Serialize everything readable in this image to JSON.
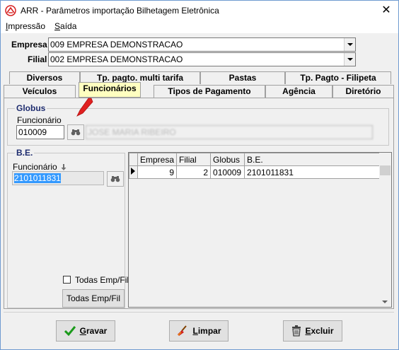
{
  "window": {
    "title": "ARR - Parâmetros importação Bilhetagem Eletrônica",
    "close_glyph": "✕"
  },
  "menu": {
    "items": [
      {
        "label_u": "I",
        "label_rest": "mpressão"
      },
      {
        "label_u": "S",
        "label_rest": "aída"
      }
    ]
  },
  "empresa": {
    "label": "Empresa",
    "value": "009 EMPRESA DEMONSTRACAO"
  },
  "filial": {
    "label": "Filial",
    "value": "002 EMPRESA DEMONSTRACAO"
  },
  "tabs": {
    "row1": [
      "Diversos",
      "Tp. pagto. multi tarifa",
      "Pastas",
      "Tp. Pagto - Filipeta"
    ],
    "row2": [
      "Veículos",
      "Funcionários",
      "Tipos de Pagamento",
      "Agência",
      "Diretório"
    ],
    "active": "Funcionários"
  },
  "globus": {
    "title": "Globus",
    "funcionario_label": "Funcionário",
    "funcionario_value": "010009",
    "name_value": "JOSE MARIA RIBEIRO"
  },
  "be": {
    "title": "B.E.",
    "funcionario_label": "Funcionário",
    "funcionario_value": "2101011831",
    "todas_checkbox_label": "Todas Emp/Fil",
    "todas_button_label": "Todas Emp/Fil"
  },
  "grid": {
    "columns": [
      "Empresa",
      "Filial",
      "Globus",
      "B.E."
    ],
    "rows": [
      {
        "empresa": "9",
        "filial": "2",
        "globus": "010009",
        "be": "2101011831"
      }
    ]
  },
  "buttons": {
    "gravar": {
      "u": "G",
      "rest": "ravar"
    },
    "limpar": {
      "u": "L",
      "rest": "impar"
    },
    "excluir": {
      "u": "E",
      "rest": "xcluir"
    }
  },
  "colors": {
    "active_tab": "#ffffc0",
    "group_title": "#1f2d6f",
    "selection": "#3399ff",
    "callout_arrow": "#e02020"
  }
}
